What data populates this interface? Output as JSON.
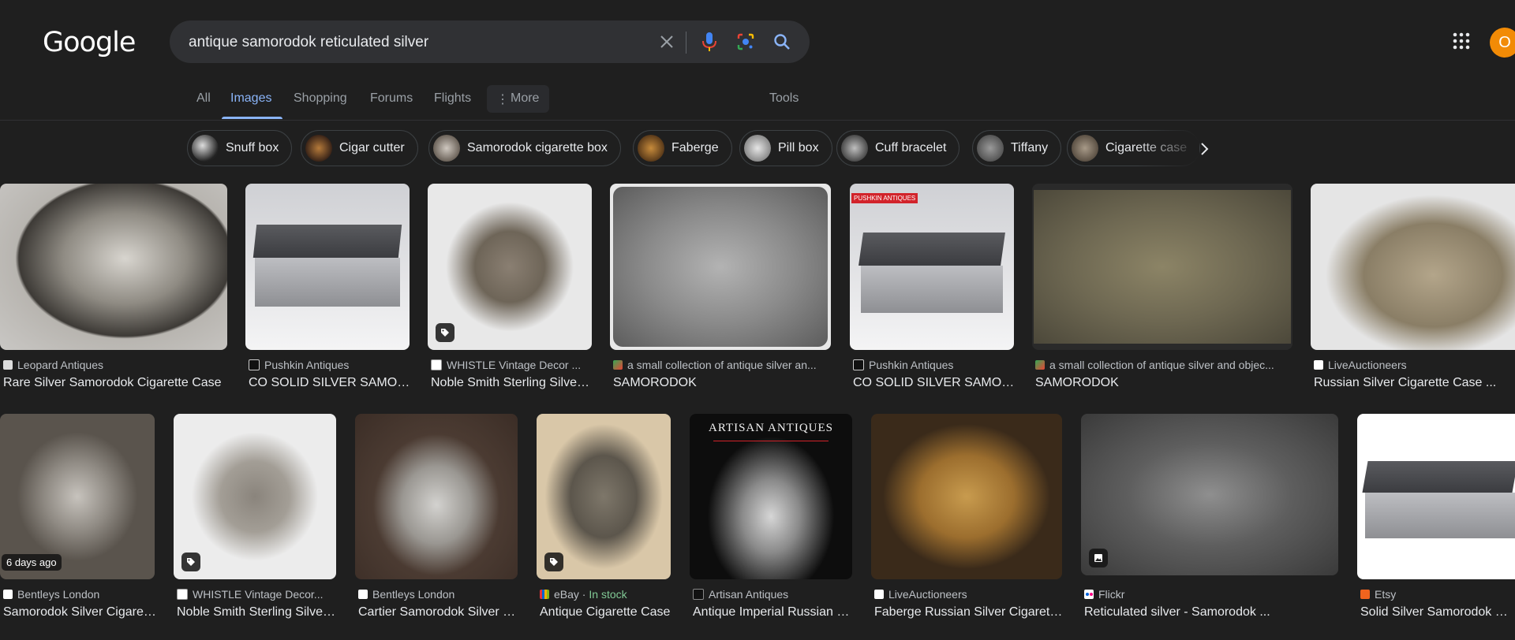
{
  "logo": "Google",
  "search": {
    "value": "antique samorodok reticulated silver"
  },
  "tabs": [
    {
      "label": "All"
    },
    {
      "label": "Images"
    },
    {
      "label": "Shopping"
    },
    {
      "label": "Forums"
    },
    {
      "label": "Flights"
    },
    {
      "label": "More"
    },
    {
      "label": "Tools"
    }
  ],
  "avatar_letter": "O",
  "chips": [
    {
      "label": "Snuff box"
    },
    {
      "label": "Cigar cutter"
    },
    {
      "label": "Samorodok cigarette box"
    },
    {
      "label": "Faberge"
    },
    {
      "label": "Pill box"
    },
    {
      "label": "Cuff bracelet"
    },
    {
      "label": "Tiffany"
    },
    {
      "label": "Cigarette case"
    }
  ],
  "results": [
    {
      "source": "Leopard Antiques",
      "title": "Rare Silver Samorodok Cigarette Case"
    },
    {
      "source": "Pushkin Antiques",
      "title": "CO SOLID SILVER SAMORODOK BOX"
    },
    {
      "source": "WHISTLE Vintage Decor ...",
      "title": "Noble Smith Sterling Silver Cuff"
    },
    {
      "source": "a small collection of antique silver an...",
      "title": "SAMORODOK"
    },
    {
      "source": "Pushkin Antiques",
      "title": "CO SOLID SILVER SAMORODOK BOX"
    },
    {
      "source": "a small collection of antique silver and objec...",
      "title": "SAMORODOK"
    },
    {
      "source": "LiveAuctioneers",
      "title": "Russian Silver Cigarette Case ..."
    },
    {
      "source": "Bentleys London",
      "title": "Samorodok Silver Cigarette Box",
      "badge": "6 days ago"
    },
    {
      "source": "WHISTLE Vintage Decor...",
      "title": "Noble Smith Sterling Silver Cuff"
    },
    {
      "source": "Bentleys London",
      "title": "Cartier Samorodok Silver Box"
    },
    {
      "source": "eBay",
      "stock": "In stock",
      "title": "Antique Cigarette Case"
    },
    {
      "source": "Artisan Antiques",
      "title": "Antique Imperial Russian Silver",
      "img_text": "ARTISAN ANTIQUES"
    },
    {
      "source": "LiveAuctioneers",
      "title": "Faberge Russian Silver Cigarette Case"
    },
    {
      "source": "Flickr",
      "title": "Reticulated silver - Samorodok ..."
    },
    {
      "source": "Etsy",
      "title": "Solid Silver Samorodok Box"
    }
  ],
  "img_label_pushkin": "PUSHKIN ANTIQUES",
  "colors": {
    "accent": "#8ab4f8",
    "background": "#1f1f1f",
    "avatar": "#f28b06",
    "instock": "#81c995"
  }
}
